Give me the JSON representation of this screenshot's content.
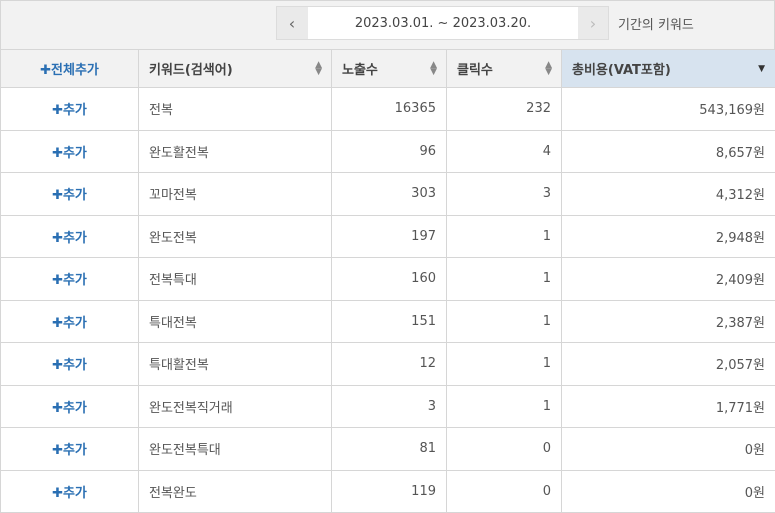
{
  "header": {
    "prev_icon": "chevron-left-icon",
    "next_icon": "chevron-right-icon",
    "date_range": "2023.03.01. ~ 2023.03.20.",
    "period_label": "기간의 키워드"
  },
  "columns": {
    "add_all": "✚전체추가",
    "keyword": "키워드(검색어)",
    "impressions": "노출수",
    "clicks": "클릭수",
    "total_cost": "총비용(VAT포함)"
  },
  "add_label": "✚추가",
  "rows": [
    {
      "keyword": "전복",
      "impressions": "16365",
      "clicks": "232",
      "cost": "543,169원"
    },
    {
      "keyword": "완도활전복",
      "impressions": "96",
      "clicks": "4",
      "cost": "8,657원"
    },
    {
      "keyword": "꼬마전복",
      "impressions": "303",
      "clicks": "3",
      "cost": "4,312원"
    },
    {
      "keyword": "완도전복",
      "impressions": "197",
      "clicks": "1",
      "cost": "2,948원"
    },
    {
      "keyword": "전복특대",
      "impressions": "160",
      "clicks": "1",
      "cost": "2,409원"
    },
    {
      "keyword": "특대전복",
      "impressions": "151",
      "clicks": "1",
      "cost": "2,387원"
    },
    {
      "keyword": "특대활전복",
      "impressions": "12",
      "clicks": "1",
      "cost": "2,057원"
    },
    {
      "keyword": "완도전복직거래",
      "impressions": "3",
      "clicks": "1",
      "cost": "1,771원"
    },
    {
      "keyword": "완도전복특대",
      "impressions": "81",
      "clicks": "0",
      "cost": "0원"
    },
    {
      "keyword": "전복완도",
      "impressions": "119",
      "clicks": "0",
      "cost": "0원"
    }
  ]
}
